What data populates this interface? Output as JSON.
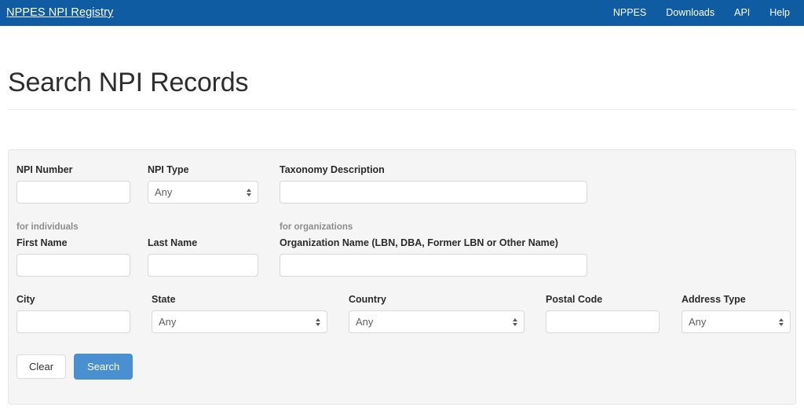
{
  "navbar": {
    "brand": "NPPES NPI Registry",
    "links": [
      {
        "label": "NPPES"
      },
      {
        "label": "Downloads"
      },
      {
        "label": "API"
      },
      {
        "label": "Help"
      }
    ],
    "background_color": "#0f5ca3"
  },
  "page": {
    "title": "Search NPI Records"
  },
  "form": {
    "background_color": "#f5f5f5",
    "hints": {
      "individuals": "for individuals",
      "organizations": "for organizations"
    },
    "fields": {
      "npi_number": {
        "label": "NPI Number",
        "value": "",
        "placeholder": "",
        "type": "text"
      },
      "npi_type": {
        "label": "NPI Type",
        "value": "Any",
        "type": "select"
      },
      "taxonomy": {
        "label": "Taxonomy Description",
        "value": "",
        "placeholder": "",
        "type": "text"
      },
      "first_name": {
        "label": "First Name",
        "value": "",
        "placeholder": "",
        "type": "text"
      },
      "last_name": {
        "label": "Last Name",
        "value": "",
        "placeholder": "",
        "type": "text"
      },
      "org_name": {
        "label": "Organization Name (LBN, DBA, Former LBN or Other Name)",
        "value": "",
        "placeholder": "",
        "type": "text"
      },
      "city": {
        "label": "City",
        "value": "",
        "placeholder": "",
        "type": "text"
      },
      "state": {
        "label": "State",
        "value": "Any",
        "type": "select"
      },
      "country": {
        "label": "Country",
        "value": "Any",
        "type": "select"
      },
      "postal_code": {
        "label": "Postal Code",
        "value": "",
        "placeholder": "",
        "type": "text"
      },
      "address_type": {
        "label": "Address Type",
        "value": "Any",
        "type": "select"
      }
    },
    "buttons": {
      "clear": {
        "label": "Clear"
      },
      "search": {
        "label": "Search",
        "color": "#4a8fd0"
      }
    }
  }
}
